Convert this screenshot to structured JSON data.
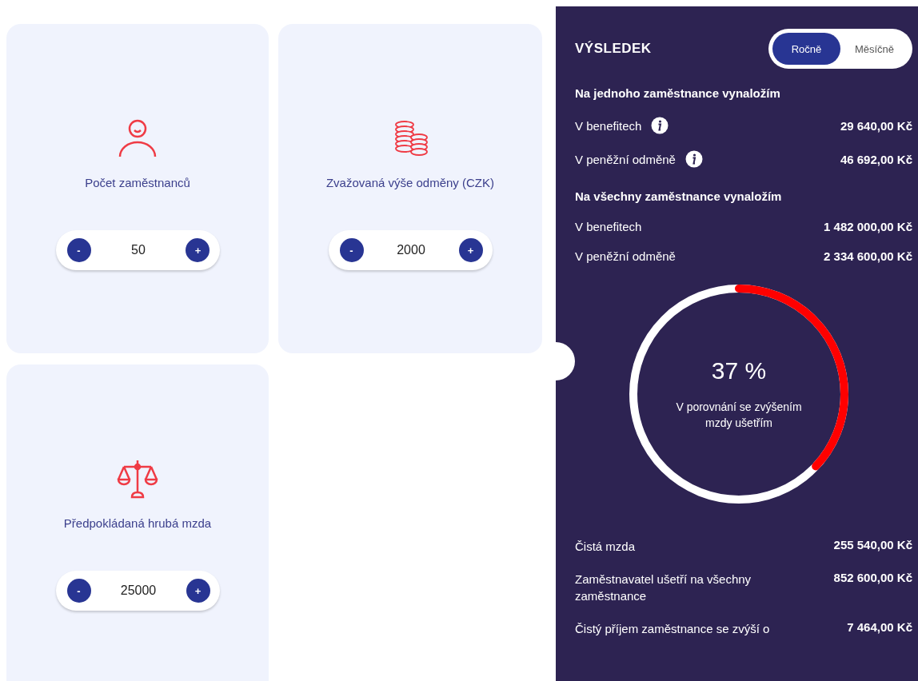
{
  "inputs": [
    {
      "label": "Počet zaměstnanců",
      "value": "50",
      "minus": "-",
      "plus": "+"
    },
    {
      "label": "Zvažovaná výše odměny (CZK)",
      "value": "2000",
      "minus": "-",
      "plus": "+"
    },
    {
      "label": "Předpokládaná hrubá mzda",
      "value": "25000",
      "minus": "-",
      "plus": "+"
    }
  ],
  "result": {
    "title": "VÝSLEDEK",
    "period_toggle": [
      {
        "label": "Ročně",
        "selected": true
      },
      {
        "label": "Měsíčně",
        "selected": false
      }
    ],
    "sections": [
      {
        "heading": "Na jednoho zaměstnance vynaložím",
        "rows": [
          {
            "label": "V benefitech",
            "value": "29 640,00 Kč",
            "info": true
          },
          {
            "label": "V peněžní odměně",
            "value": "46 692,00 Kč",
            "info": true
          }
        ]
      },
      {
        "heading": "Na všechny zaměstnance vynaložím",
        "rows": [
          {
            "label": "V benefitech",
            "value": "1 482 000,00 Kč",
            "info": false
          },
          {
            "label": "V peněžní odměně",
            "value": "2 334 600,00 Kč",
            "info": false
          }
        ]
      }
    ],
    "savings": {
      "level": 0.37,
      "percent": "37 %",
      "caption": "V porovnání se zvýšením mzdy ušetřím"
    },
    "summary": [
      {
        "label": "Čistá mzda",
        "value": "255 540,00 Kč"
      },
      {
        "label": "Zaměstnavatel ušetří na všechny zaměstnance",
        "value": "852 600,00 Kč"
      },
      {
        "label": "Čistý příjem zaměstnance se zvýší o",
        "value": "7 464,00 Kč"
      }
    ]
  }
}
